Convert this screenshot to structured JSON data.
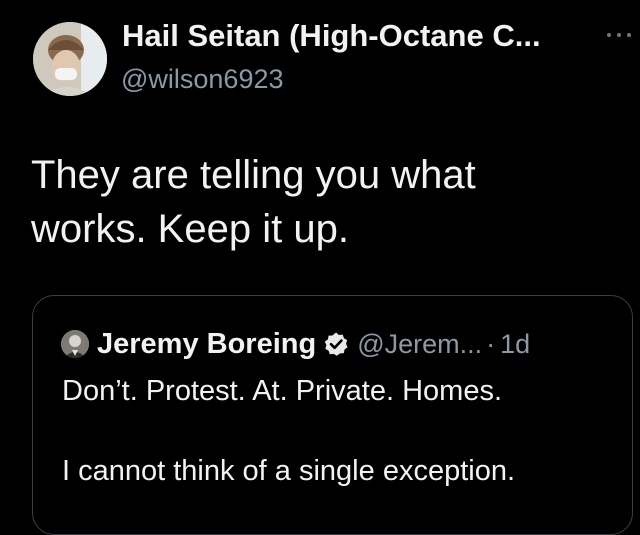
{
  "tweet": {
    "author": {
      "display_name": "Hail Seitan (High-Octane C...",
      "handle": "@wilson6923",
      "avatar_icon": "user-avatar-photo"
    },
    "more_icon": "more-options-icon",
    "text_lines": [
      "They are telling you what",
      "works. Keep it up."
    ]
  },
  "quoted_tweet": {
    "author": {
      "display_name": "Jeremy Boreing",
      "handle": "@Jerem...",
      "verified_icon": "verified-badge-icon",
      "avatar_icon": "user-avatar-photo"
    },
    "separator": "·",
    "time": "1d",
    "text_lines": [
      "Don’t. Protest. At. Private. Homes.",
      "I cannot think of a single exception."
    ]
  },
  "colors": {
    "background": "#000000",
    "primary_text": "#f2f2f2",
    "secondary_text": "#8b98a5",
    "border": "#3b3f44"
  }
}
